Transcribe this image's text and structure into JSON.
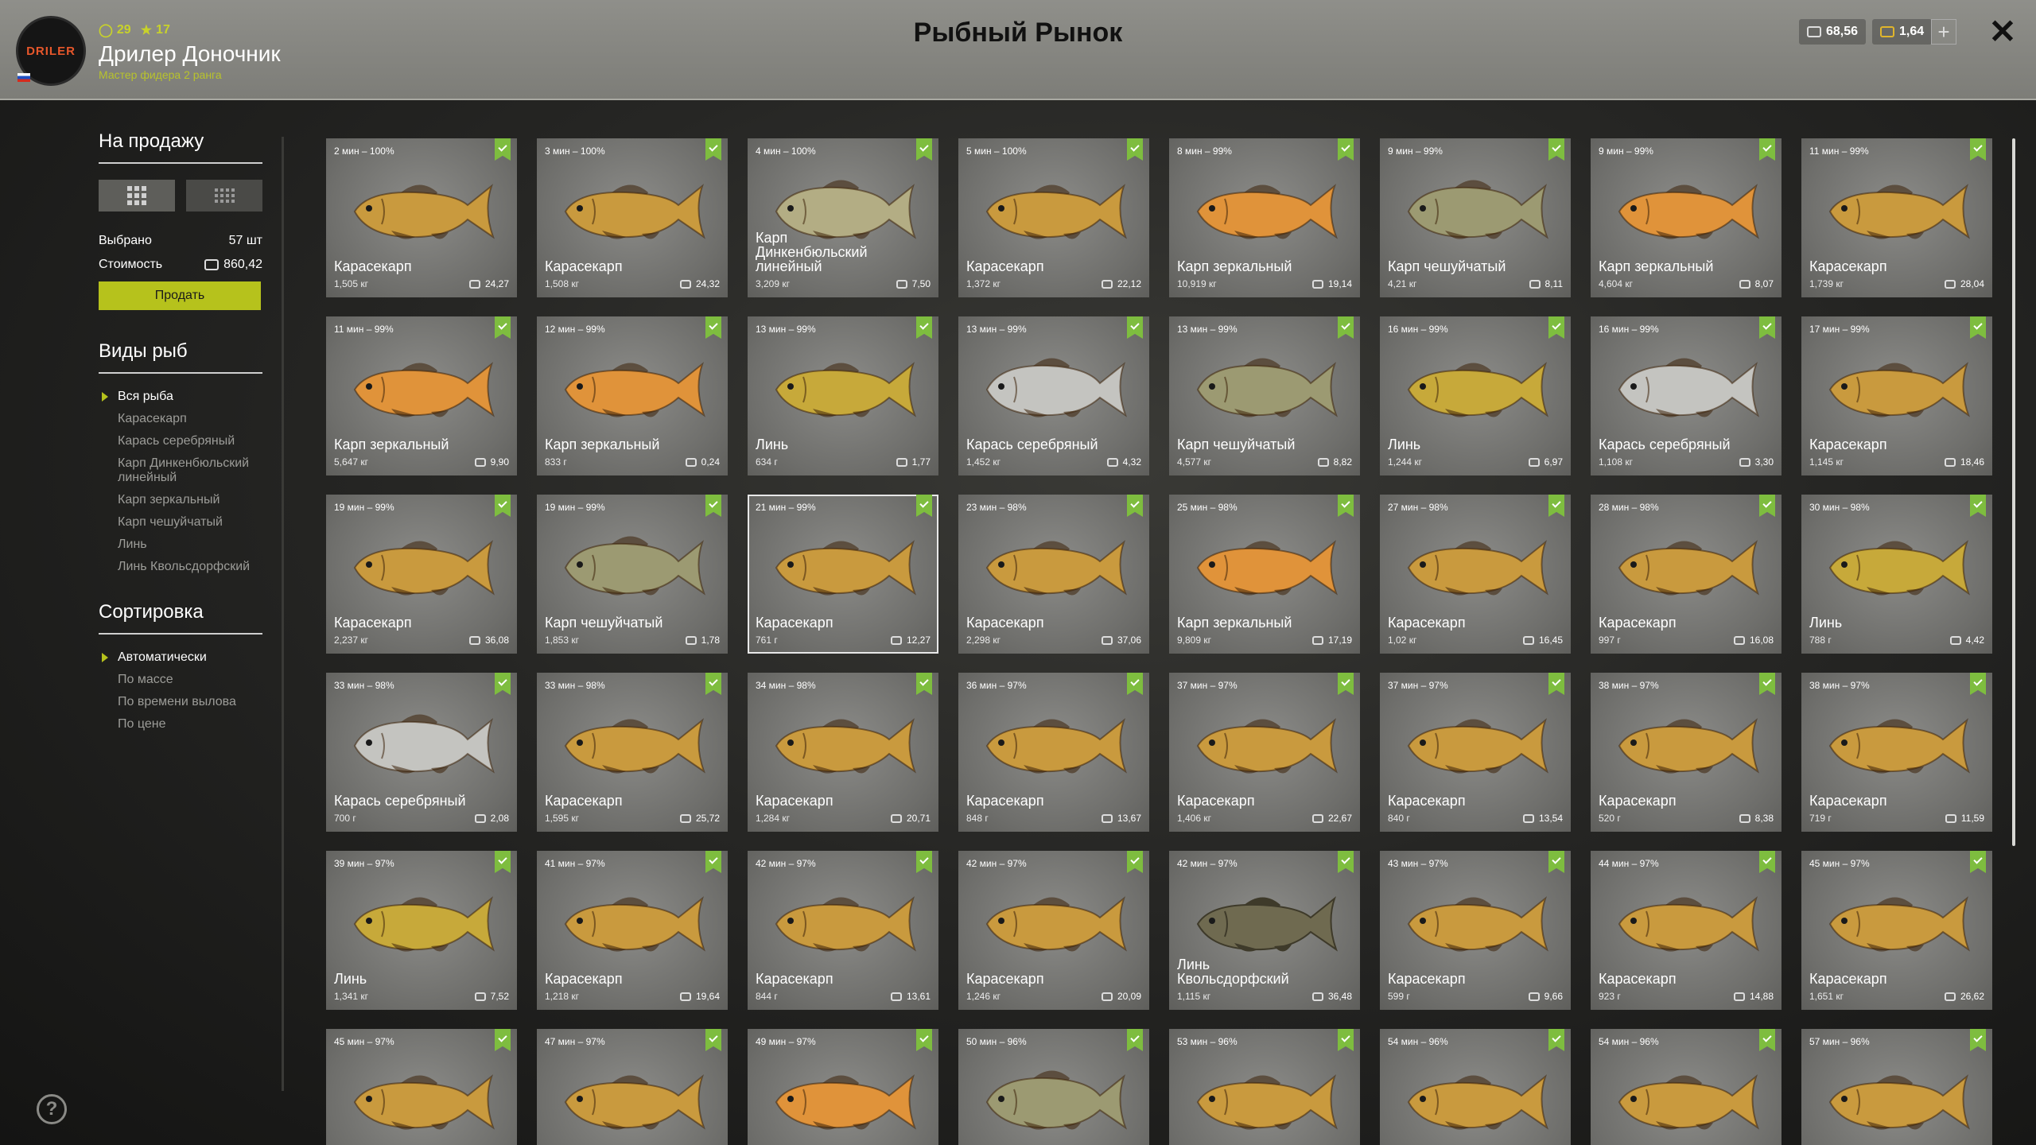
{
  "header": {
    "title": "Рыбный Рынок",
    "player": {
      "name": "Дрилер Доночник",
      "rank": "Мастер фидера 2 ранга",
      "level": "29",
      "stars": "17",
      "logo_text": "DRILER"
    },
    "currency": {
      "silver": "68,56",
      "gold": "1,64"
    },
    "plus_label": "+",
    "close_label": "✕"
  },
  "sidebar": {
    "for_sale_title": "На продажу",
    "selected_label": "Выбрано",
    "selected_value": "57 шт",
    "cost_label": "Стоимость",
    "cost_value": "860,42",
    "sell_button": "Продать",
    "species_title": "Виды рыб",
    "species": [
      "Вся рыба",
      "Карасекарп",
      "Карась серебряный",
      "Карп Динкенбюльский линейный",
      "Карп зеркальный",
      "Карп чешуйчатый",
      "Линь",
      "Линь Квольсдорфский"
    ],
    "sort_title": "Сортировка",
    "sort": [
      "Автоматически",
      "По массе",
      "По времени вылова",
      "По цене"
    ],
    "help_label": "?"
  },
  "colors": {
    "accent": "#b6c21c",
    "bookmark": "#7ebd3f",
    "carp_crucian": "#c99a3e",
    "mirror_carp": "#e0933a",
    "common_carp": "#9c9a72",
    "tench": "#c7a93a",
    "silver_crucian": "#c4c4c0",
    "linear_carp": "#b3ad84",
    "kwolsdorf_tench": "#6f6a50"
  },
  "fish": [
    {
      "time": "2 мин – 100%",
      "name": "Карасекарп",
      "weight": "1,505 кг",
      "price": "24,27",
      "kind": "carp_crucian"
    },
    {
      "time": "3 мин – 100%",
      "name": "Карасекарп",
      "weight": "1,508 кг",
      "price": "24,32",
      "kind": "carp_crucian"
    },
    {
      "time": "4 мин – 100%",
      "name": "Карп Динкенбюльский линейный",
      "weight": "3,209 кг",
      "price": "7,50",
      "kind": "linear_carp"
    },
    {
      "time": "5 мин – 100%",
      "name": "Карасекарп",
      "weight": "1,372 кг",
      "price": "22,12",
      "kind": "carp_crucian"
    },
    {
      "time": "8 мин – 99%",
      "name": "Карп зеркальный",
      "weight": "10,919 кг",
      "price": "19,14",
      "kind": "mirror_carp"
    },
    {
      "time": "9 мин – 99%",
      "name": "Карп чешуйчатый",
      "weight": "4,21 кг",
      "price": "8,11",
      "kind": "common_carp"
    },
    {
      "time": "9 мин – 99%",
      "name": "Карп зеркальный",
      "weight": "4,604 кг",
      "price": "8,07",
      "kind": "mirror_carp"
    },
    {
      "time": "11 мин – 99%",
      "name": "Карасекарп",
      "weight": "1,739 кг",
      "price": "28,04",
      "kind": "carp_crucian"
    },
    {
      "time": "11 мин – 99%",
      "name": "Карп зеркальный",
      "weight": "5,647 кг",
      "price": "9,90",
      "kind": "mirror_carp"
    },
    {
      "time": "12 мин – 99%",
      "name": "Карп зеркальный",
      "weight": "833 г",
      "price": "0,24",
      "kind": "mirror_carp"
    },
    {
      "time": "13 мин – 99%",
      "name": "Линь",
      "weight": "634 г",
      "price": "1,77",
      "kind": "tench"
    },
    {
      "time": "13 мин – 99%",
      "name": "Карась серебряный",
      "weight": "1,452 кг",
      "price": "4,32",
      "kind": "silver_crucian"
    },
    {
      "time": "13 мин – 99%",
      "name": "Карп чешуйчатый",
      "weight": "4,577 кг",
      "price": "8,82",
      "kind": "common_carp"
    },
    {
      "time": "16 мин – 99%",
      "name": "Линь",
      "weight": "1,244 кг",
      "price": "6,97",
      "kind": "tench"
    },
    {
      "time": "16 мин – 99%",
      "name": "Карась серебряный",
      "weight": "1,108 кг",
      "price": "3,30",
      "kind": "silver_crucian"
    },
    {
      "time": "17 мин – 99%",
      "name": "Карасекарп",
      "weight": "1,145 кг",
      "price": "18,46",
      "kind": "carp_crucian"
    },
    {
      "time": "19 мин – 99%",
      "name": "Карасекарп",
      "weight": "2,237 кг",
      "price": "36,08",
      "kind": "carp_crucian"
    },
    {
      "time": "19 мин – 99%",
      "name": "Карп чешуйчатый",
      "weight": "1,853 кг",
      "price": "1,78",
      "kind": "common_carp"
    },
    {
      "time": "21 мин – 99%",
      "name": "Карасекарп",
      "weight": "761 г",
      "price": "12,27",
      "kind": "carp_crucian",
      "selected": true
    },
    {
      "time": "23 мин – 98%",
      "name": "Карасекарп",
      "weight": "2,298 кг",
      "price": "37,06",
      "kind": "carp_crucian"
    },
    {
      "time": "25 мин – 98%",
      "name": "Карп зеркальный",
      "weight": "9,809 кг",
      "price": "17,19",
      "kind": "mirror_carp"
    },
    {
      "time": "27 мин – 98%",
      "name": "Карасекарп",
      "weight": "1,02 кг",
      "price": "16,45",
      "kind": "carp_crucian"
    },
    {
      "time": "28 мин – 98%",
      "name": "Карасекарп",
      "weight": "997 г",
      "price": "16,08",
      "kind": "carp_crucian"
    },
    {
      "time": "30 мин – 98%",
      "name": "Линь",
      "weight": "788 г",
      "price": "4,42",
      "kind": "tench"
    },
    {
      "time": "33 мин – 98%",
      "name": "Карась серебряный",
      "weight": "700 г",
      "price": "2,08",
      "kind": "silver_crucian"
    },
    {
      "time": "33 мин – 98%",
      "name": "Карасекарп",
      "weight": "1,595 кг",
      "price": "25,72",
      "kind": "carp_crucian"
    },
    {
      "time": "34 мин – 98%",
      "name": "Карасекарп",
      "weight": "1,284 кг",
      "price": "20,71",
      "kind": "carp_crucian"
    },
    {
      "time": "36 мин – 97%",
      "name": "Карасекарп",
      "weight": "848 г",
      "price": "13,67",
      "kind": "carp_crucian"
    },
    {
      "time": "37 мин – 97%",
      "name": "Карасекарп",
      "weight": "1,406 кг",
      "price": "22,67",
      "kind": "carp_crucian"
    },
    {
      "time": "37 мин – 97%",
      "name": "Карасекарп",
      "weight": "840 г",
      "price": "13,54",
      "kind": "carp_crucian"
    },
    {
      "time": "38 мин – 97%",
      "name": "Карасекарп",
      "weight": "520 г",
      "price": "8,38",
      "kind": "carp_crucian"
    },
    {
      "time": "38 мин – 97%",
      "name": "Карасекарп",
      "weight": "719 г",
      "price": "11,59",
      "kind": "carp_crucian"
    },
    {
      "time": "39 мин – 97%",
      "name": "Линь",
      "weight": "1,341 кг",
      "price": "7,52",
      "kind": "tench"
    },
    {
      "time": "41 мин – 97%",
      "name": "Карасекарп",
      "weight": "1,218 кг",
      "price": "19,64",
      "kind": "carp_crucian"
    },
    {
      "time": "42 мин – 97%",
      "name": "Карасекарп",
      "weight": "844 г",
      "price": "13,61",
      "kind": "carp_crucian"
    },
    {
      "time": "42 мин – 97%",
      "name": "Карасекарп",
      "weight": "1,246 кг",
      "price": "20,09",
      "kind": "carp_crucian"
    },
    {
      "time": "42 мин – 97%",
      "name": "Линь Квольсдорфский",
      "weight": "1,115 кг",
      "price": "36,48",
      "kind": "kwolsdorf_tench"
    },
    {
      "time": "43 мин – 97%",
      "name": "Карасекарп",
      "weight": "599 г",
      "price": "9,66",
      "kind": "carp_crucian"
    },
    {
      "time": "44 мин – 97%",
      "name": "Карасекарп",
      "weight": "923 г",
      "price": "14,88",
      "kind": "carp_crucian"
    },
    {
      "time": "45 мин – 97%",
      "name": "Карасекарп",
      "weight": "1,651 кг",
      "price": "26,62",
      "kind": "carp_crucian"
    },
    {
      "time": "45 мин – 97%",
      "name": "",
      "weight": "",
      "price": "",
      "kind": "carp_crucian"
    },
    {
      "time": "47 мин – 97%",
      "name": "",
      "weight": "",
      "price": "",
      "kind": "carp_crucian"
    },
    {
      "time": "49 мин – 97%",
      "name": "",
      "weight": "",
      "price": "",
      "kind": "mirror_carp"
    },
    {
      "time": "50 мин – 96%",
      "name": "",
      "weight": "",
      "price": "",
      "kind": "common_carp"
    },
    {
      "time": "53 мин – 96%",
      "name": "",
      "weight": "",
      "price": "",
      "kind": "carp_crucian"
    },
    {
      "time": "54 мин – 96%",
      "name": "",
      "weight": "",
      "price": "",
      "kind": "carp_crucian"
    },
    {
      "time": "54 мин – 96%",
      "name": "",
      "weight": "",
      "price": "",
      "kind": "carp_crucian"
    },
    {
      "time": "57 мин – 96%",
      "name": "",
      "weight": "",
      "price": "",
      "kind": "carp_crucian"
    }
  ]
}
